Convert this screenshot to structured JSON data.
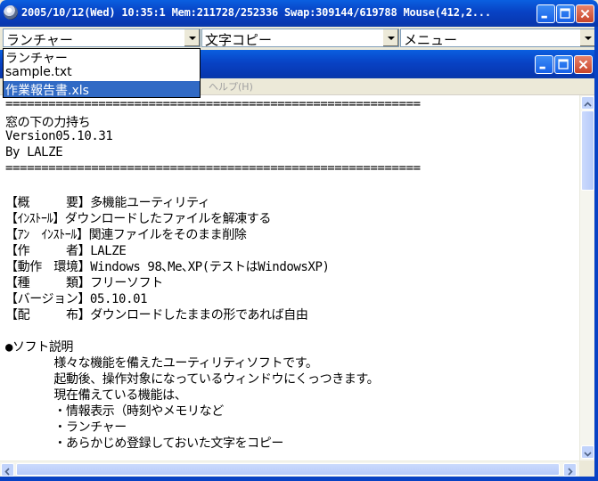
{
  "window": {
    "title": "2005/10/12(Wed) 10:35:1  Mem:211728/252336  Swap:309144/619788  Mouse(412,2...",
    "buttons": [
      "minimize",
      "maximize",
      "close"
    ]
  },
  "combos": [
    {
      "value": "ランチャー"
    },
    {
      "value": "文字コピー"
    },
    {
      "value": "メニュー"
    }
  ],
  "launcher_dropdown": {
    "items": [
      "ランチャー",
      "sample.txt",
      "作業報告書.xls"
    ],
    "selected_index": 2
  },
  "inner_window": {
    "menu_help": "ヘルプ(H)"
  },
  "document": {
    "lines": [
      "==========================================================",
      "窓の下の力持ち",
      "Version05.10.31",
      "By LALZE",
      "==========================================================",
      "",
      "【概　　　要】多機能ユーティリティ",
      "【ｲﾝｽﾄｰﾙ】ダウンロードしたファイルを解凍する",
      "【ｱﾝ　ｲﾝｽﾄｰﾙ】関連ファイルをそのまま削除",
      "【作　　　者】LALZE",
      "【動作　環境】Windows 98､Me､XP(テストはWindowsXP)",
      "【種　　　類】フリーソフト",
      "【バージョン】05.10.01",
      "【配　　　布】ダウンロードしたままの形であれば自由",
      "",
      "●ソフト説明",
      "　　　　様々な機能を備えたユーティリティソフトです。",
      "　　　　起動後、操作対象になっているウィンドウにくっつきます。",
      "　　　　現在備えている機能は、",
      "　　　　・情報表示（時刻やメモリなど",
      "　　　　・ランチャー",
      "　　　　・あらかじめ登録しておいた文字をコピー"
    ]
  }
}
